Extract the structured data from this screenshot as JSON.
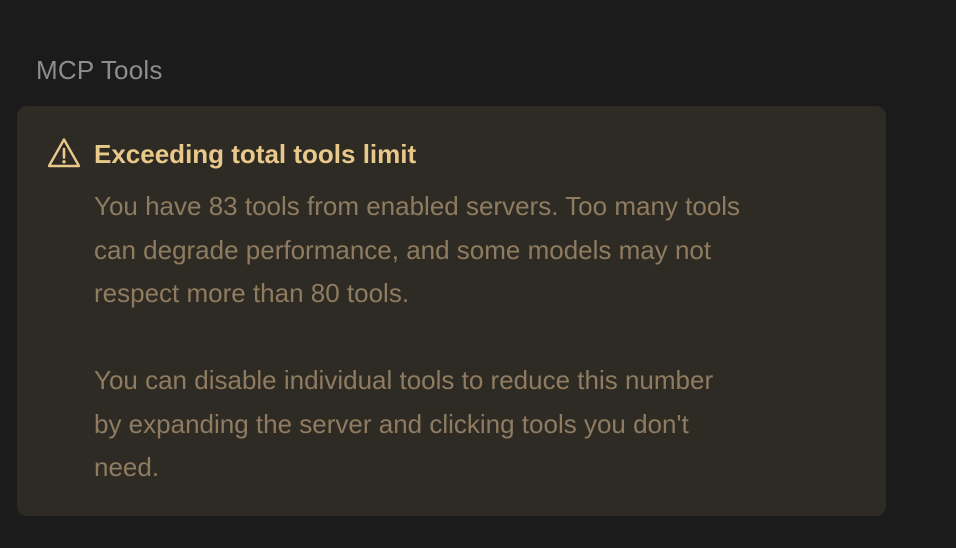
{
  "section": {
    "title": "MCP Tools"
  },
  "warning": {
    "icon": "warning-triangle-icon",
    "title": "Exceeding total tools limit",
    "paragraph1_line1": "You have 83 tools from enabled servers. Too many tools",
    "paragraph1_line2": "can degrade performance, and some models may not",
    "paragraph1_line3": "respect more than 80 tools.",
    "paragraph2_line1": "You can disable individual tools to reduce this number",
    "paragraph2_line2": "by expanding the server and clicking tools you don't",
    "paragraph2_line3": "need."
  },
  "colors": {
    "background": "#1b1b1b",
    "card_background": "#2e2b25",
    "title_color": "#e9c98a",
    "body_color": "#8f7c60",
    "section_title_color": "#8d8d8d"
  }
}
